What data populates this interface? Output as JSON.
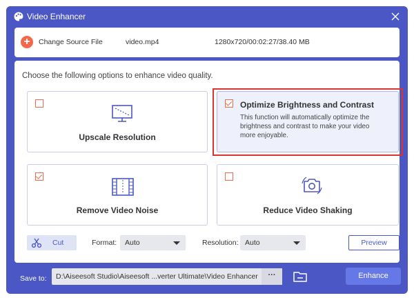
{
  "window": {
    "title": "Video Enhancer"
  },
  "source": {
    "change_label": "Change Source File",
    "file_name": "video.mp4",
    "file_info": "1280x720/00:02:27/38.40 MB"
  },
  "main": {
    "prompt": "Choose the following options to enhance video quality.",
    "options": {
      "upscale": {
        "label": "Upscale Resolution",
        "checked": false
      },
      "brightness": {
        "label": "Optimize Brightness and Contrast",
        "description": "This function will automatically optimize the brightness and contrast to make your video more enjoyable.",
        "checked": true
      },
      "noise": {
        "label": "Remove Video Noise",
        "checked": true
      },
      "shaking": {
        "label": "Reduce Video Shaking",
        "checked": false
      }
    }
  },
  "toolbar": {
    "cut_label": "Cut",
    "format_label": "Format:",
    "format_value": "Auto",
    "resolution_label": "Resolution:",
    "resolution_value": "Auto",
    "preview_label": "Preview"
  },
  "footer": {
    "save_label": "Save to:",
    "save_path": "D:\\Aiseesoft Studio\\Aiseesoft ...verter Ultimate\\Video Enhancer",
    "dots_label": "···",
    "enhance_label": "Enhance"
  },
  "colors": {
    "accent": "#4b57c4",
    "orange": "#f26a4b",
    "highlight": "#d9352f"
  },
  "icons": [
    "palette-icon",
    "close-icon",
    "add-icon",
    "monitor-icon",
    "film-icon",
    "camera-icon",
    "scissors-icon",
    "folder-icon"
  ]
}
